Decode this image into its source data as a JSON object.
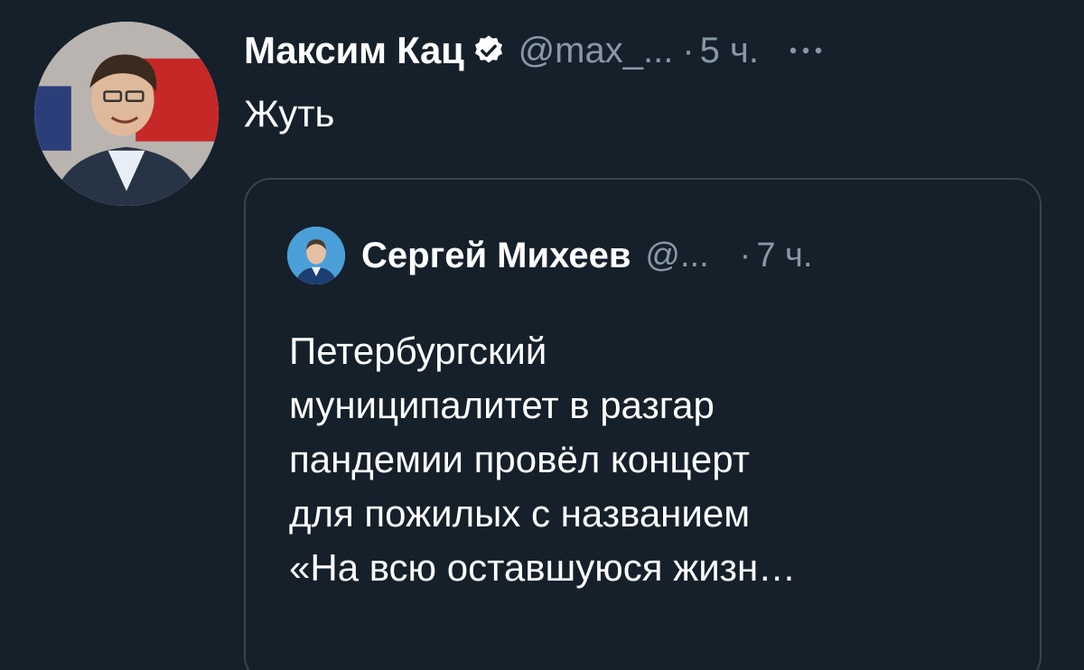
{
  "tweet": {
    "author_name": "Максим Кац",
    "author_handle": "@max_...",
    "separator": "·",
    "time": "5 ч.",
    "text": "Жуть",
    "icons": {
      "avatar": "user-avatar",
      "verified": "verified-badge-icon",
      "more": "more-options-icon"
    }
  },
  "quoted_tweet": {
    "author_name": "Сергей Михеев",
    "author_handle": "@...",
    "separator": "·",
    "time": "7 ч.",
    "text_lines": [
      "Петербургский",
      "муниципалитет в разгар",
      "пандемии провёл концерт",
      "для пожилых с названием",
      "«На всю оставшуюся жизн…"
    ]
  },
  "colors": {
    "background": "#15202b",
    "primary_text": "#ffffff",
    "secondary_text": "#8899a6",
    "border": "#38444d"
  }
}
